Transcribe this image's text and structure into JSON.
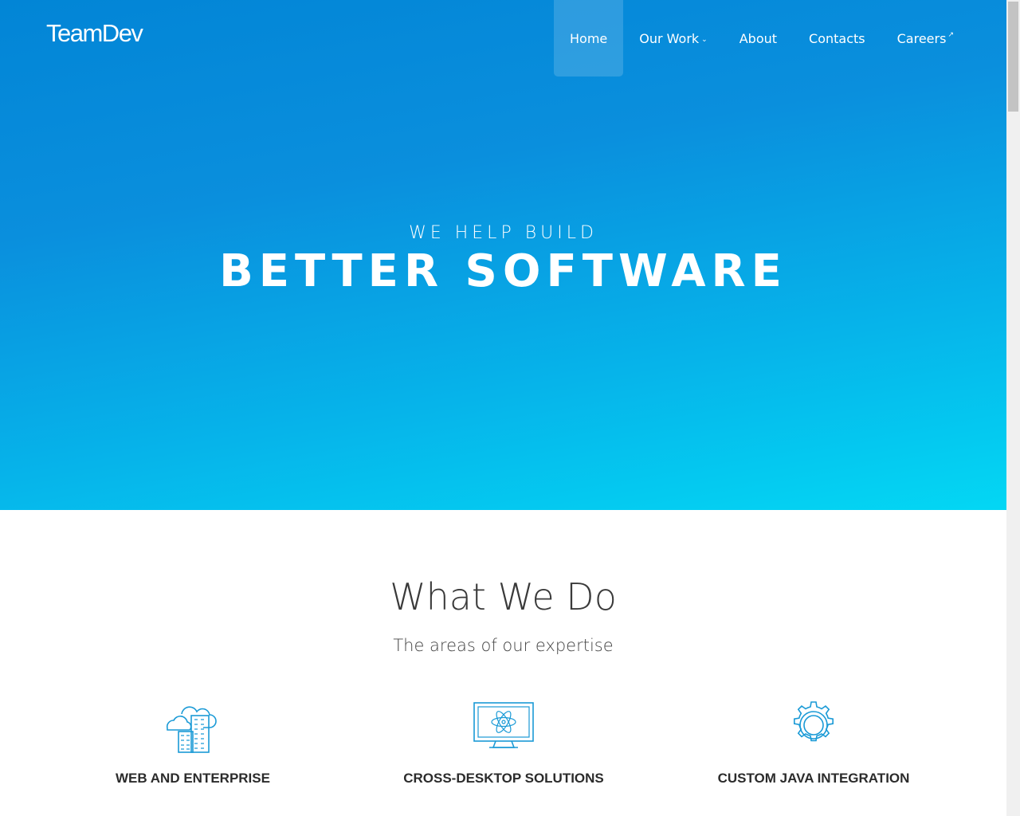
{
  "brand": {
    "logo_text": "TeamDev"
  },
  "nav": {
    "items": [
      {
        "label": "Home",
        "active": true
      },
      {
        "label": "Our Work",
        "has_dropdown": true
      },
      {
        "label": "About"
      },
      {
        "label": "Contacts"
      },
      {
        "label": "Careers",
        "external": true
      }
    ]
  },
  "hero": {
    "subtitle": "WE HELP BUILD",
    "title": "BETTER SOFTWARE"
  },
  "section": {
    "title": "What We Do",
    "subtitle": "The areas of our expertise"
  },
  "cards": [
    {
      "icon": "cloud-building-icon",
      "label": "WEB AND ENTERPRISE"
    },
    {
      "icon": "desktop-atom-icon",
      "label": "CROSS-DESKTOP SOLUTIONS"
    },
    {
      "icon": "gear-icon",
      "label": "CUSTOM JAVA INTEGRATION"
    }
  ],
  "colors": {
    "hero_top": "#0285d6",
    "hero_bottom": "#03d7f4",
    "icon_blue": "#1a9ad6"
  }
}
